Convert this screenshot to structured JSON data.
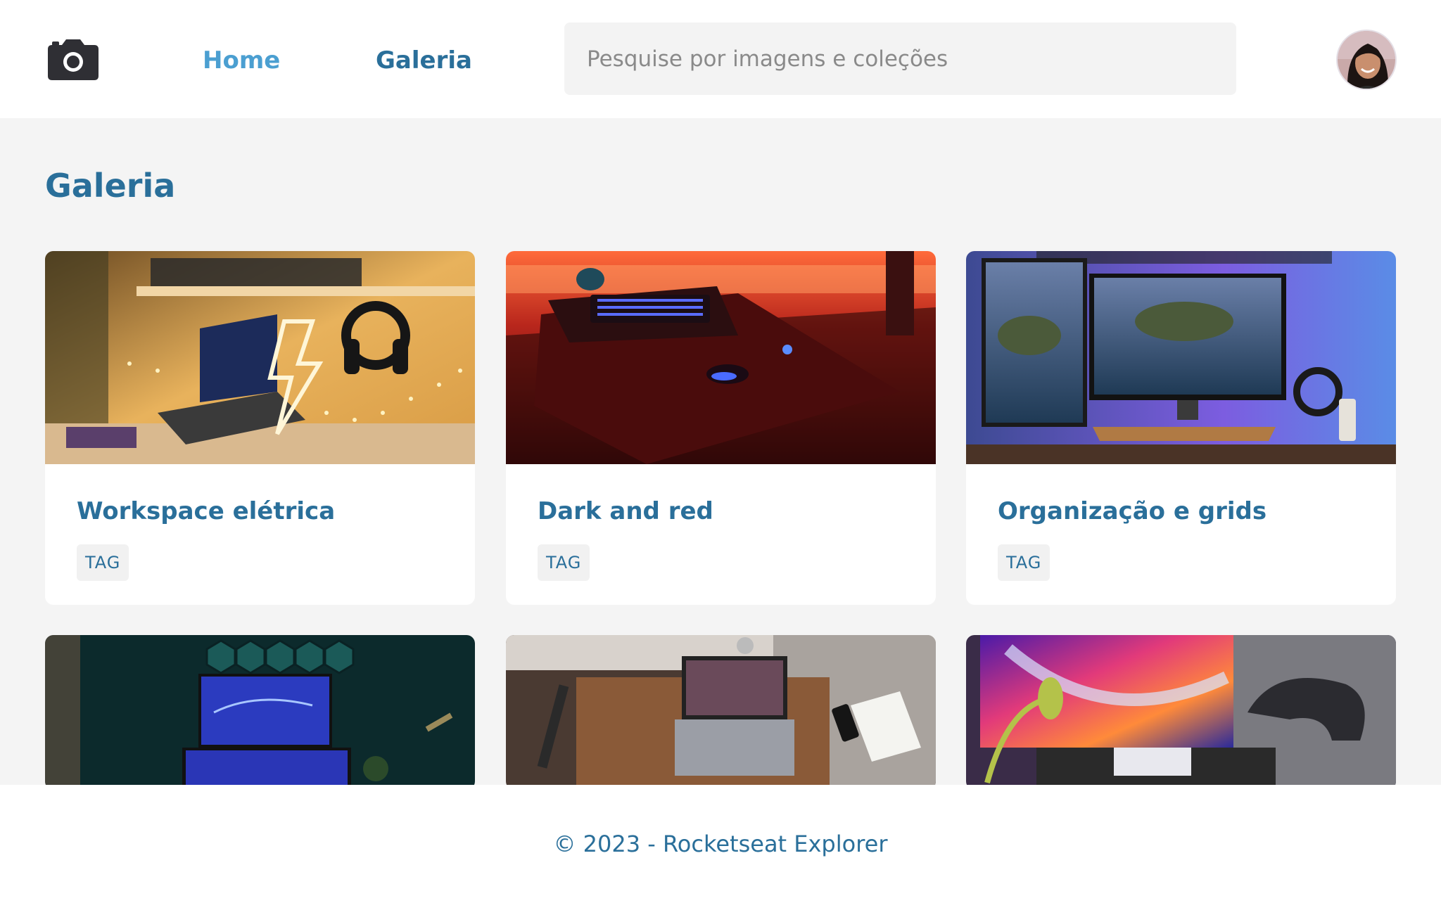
{
  "header": {
    "logo_icon": "camera-icon",
    "nav": [
      {
        "label": "Home",
        "color": "#4b9fd1"
      },
      {
        "label": "Galeria",
        "color": "#2a6f9a"
      }
    ],
    "search": {
      "placeholder": "Pesquise por imagens e coleções",
      "value": ""
    },
    "avatar_icon": "user-avatar"
  },
  "main": {
    "title": "Galeria",
    "cards": [
      {
        "title": "Workspace elétrica",
        "tag": "TAG",
        "image": "laptop-neon-lightning-desk"
      },
      {
        "title": "Dark and red",
        "tag": "TAG",
        "image": "red-lit-keyboard-desk"
      },
      {
        "title": "Organização e grids",
        "tag": "TAG",
        "image": "dual-monitor-island-wallpaper"
      },
      {
        "image": "teal-hexagon-monitors"
      },
      {
        "image": "laptop-notebook-desk-topview"
      },
      {
        "image": "colorful-monitor-office-chair"
      }
    ]
  },
  "footer": {
    "text": "© 2023 - Rocketseat Explorer"
  },
  "colors": {
    "primary": "#2a6f9a",
    "link": "#4b9fd1",
    "background": "#f4f4f4",
    "surface": "#ffffff"
  }
}
